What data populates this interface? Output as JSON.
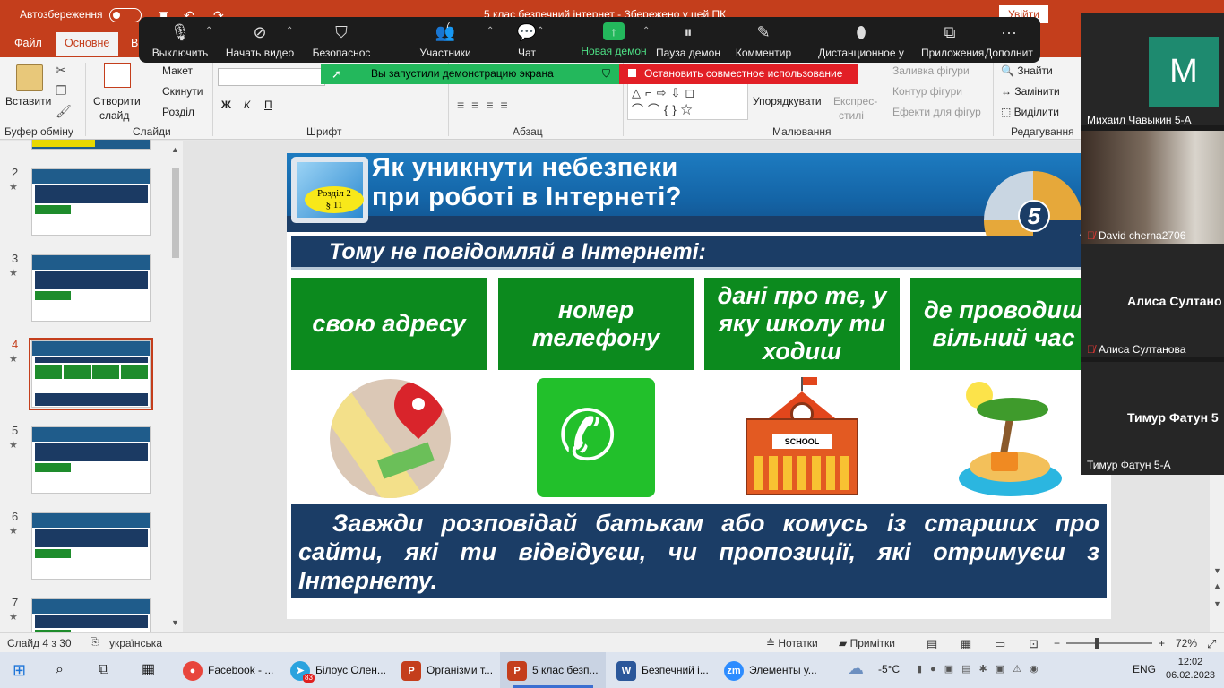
{
  "titlebar": {
    "autosave": "Автозбереження",
    "doc_title": "5 клас безпечний інтернет  -  Збережено у цей ПК",
    "signin": "Увійти"
  },
  "tabs": [
    "Файл",
    "Основне",
    "В"
  ],
  "ribbon": {
    "paste": "Вставити",
    "clipboard_group": "Буфер обміну",
    "new_slide_1": "Створити",
    "new_slide_2": "слайд",
    "layout": "Макет",
    "reset": "Скинути",
    "section": "Розділ",
    "slides_group": "Слайди",
    "font_group": "Шрифт",
    "paragraph_group": "Абзац",
    "arrange": "Упорядкувати",
    "quick_styles_1": "Експрес-",
    "quick_styles_2": "стилі",
    "shape_fill": "Заливка фігури",
    "shape_outline": "Контур фігури",
    "shape_effects": "Ефекти для фігур",
    "drawing_group": "Малювання",
    "find": "Знайти",
    "replace": "Замінити",
    "select": "Виділити",
    "editing_group": "Редагування",
    "bold": "Ж",
    "italic": "К",
    "underline": "П"
  },
  "zoom_toolbar": {
    "items": [
      {
        "label": "Выключить",
        "icon": "microphone-icon"
      },
      {
        "label": "Начать видео",
        "icon": "video-off-icon"
      },
      {
        "label": "Безопаснос",
        "icon": "shield-icon"
      },
      {
        "label": "Участники",
        "icon": "participants-icon",
        "count": "7"
      },
      {
        "label": "Чат",
        "icon": "chat-icon"
      },
      {
        "label": "Новая демон",
        "icon": "share-screen-icon"
      },
      {
        "label": "Пауза демон",
        "icon": "pause-icon"
      },
      {
        "label": "Комментир",
        "icon": "pen-icon"
      },
      {
        "label": "Дистанционное у",
        "icon": "mouse-icon"
      },
      {
        "label": "Приложения",
        "icon": "apps-icon"
      },
      {
        "label": "Дополнит",
        "icon": "more-icon"
      }
    ],
    "sharing_notice": "Вы запустили демонстрацию экрана",
    "stop_sharing": "Остановить совместное использование",
    "accent_green": "#23b85c",
    "accent_red": "#e21f26"
  },
  "thumbnails": [
    {
      "num": "2",
      "star": "★"
    },
    {
      "num": "3",
      "star": "★"
    },
    {
      "num": "4",
      "star": "★"
    },
    {
      "num": "5",
      "star": "★"
    },
    {
      "num": "6",
      "star": "★"
    },
    {
      "num": "7",
      "star": "★"
    }
  ],
  "slide": {
    "badge_line1": "Розділ 2",
    "badge_line2": "§ 11",
    "title_line1": "Як уникнути небезпеки",
    "title_line2": "при роботі в Інтернеті?",
    "subtitle": "Тому не повідомляй в Інтернеті:",
    "boxes": [
      "свою адресу",
      "номер телефону",
      "дані про те, у яку школу ти ходиш",
      "де проводиш вільний час"
    ],
    "school_sign": "SCHOOL",
    "bottom_text": "Завжди розповідай батькам або комусь із старших про сайти, які ти відвідуєш, чи пропозиції, які отримуєш з Інтернету.",
    "logo_number": "5"
  },
  "zoom_panel": {
    "avatar_letter": "М",
    "avatar_color": "#1e8a6f",
    "p1": "Михаил Чавыкин 5-А",
    "p2": "David cherna2706",
    "p3_big": "Алиса Султано",
    "p3": "Алиса Султанова",
    "p4_big": "Тимур Фатун 5",
    "p4": "Тимур Фатун 5-А"
  },
  "status": {
    "slide_info": "Слайд 4 з 30",
    "language": "українська",
    "notes": "Нотатки",
    "comments": "Примітки",
    "zoom": "72%"
  },
  "taskbar": {
    "apps": [
      {
        "label": "Facebook - ...",
        "icon": "chrome-icon"
      },
      {
        "label": "Білоус Олен...",
        "icon": "telegram-icon",
        "badge": "83"
      },
      {
        "label": "Організми т...",
        "icon": "powerpoint-icon"
      },
      {
        "label": "5 клас безп...",
        "icon": "powerpoint-icon"
      },
      {
        "label": "Безпечний і...",
        "icon": "word-icon"
      },
      {
        "label": "Элементы у...",
        "icon": "zoom-icon"
      }
    ],
    "weather": "-5°C",
    "lang": "ENG",
    "time": "12:02",
    "date": "06.02.2023"
  }
}
